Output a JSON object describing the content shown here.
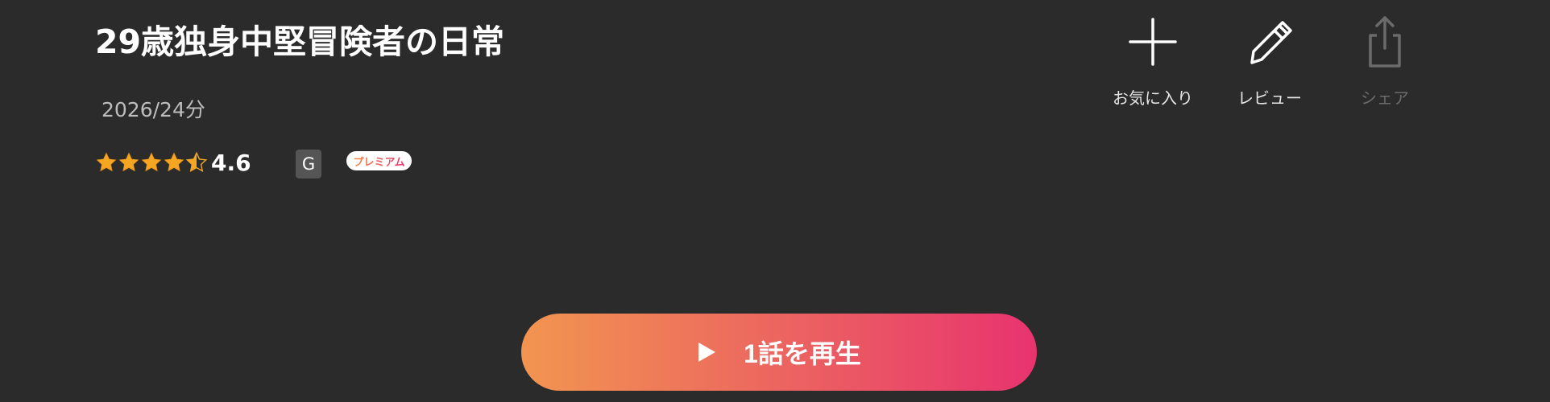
{
  "header": {
    "title": "29歳独身中堅冒険者の日常",
    "meta": "2026/24分"
  },
  "rating": {
    "value": "4.6",
    "stars_value": 4.6,
    "stars_max": 5,
    "star_color": "#f5a623"
  },
  "badges": {
    "age_rating": "G",
    "premium": "プレミアム"
  },
  "actions": {
    "favorite": {
      "label": "お気に入り",
      "icon": "plus-icon"
    },
    "review": {
      "label": "レビュー",
      "icon": "pencil-icon"
    },
    "share": {
      "label": "シェア",
      "icon": "share-icon",
      "enabled": false
    }
  },
  "play": {
    "label": "1話を再生",
    "icon": "play-icon"
  },
  "colors": {
    "background": "#2b2b2b",
    "accent_start": "#f29550",
    "accent_end": "#e8336f",
    "disabled": "#6b6b6b"
  }
}
